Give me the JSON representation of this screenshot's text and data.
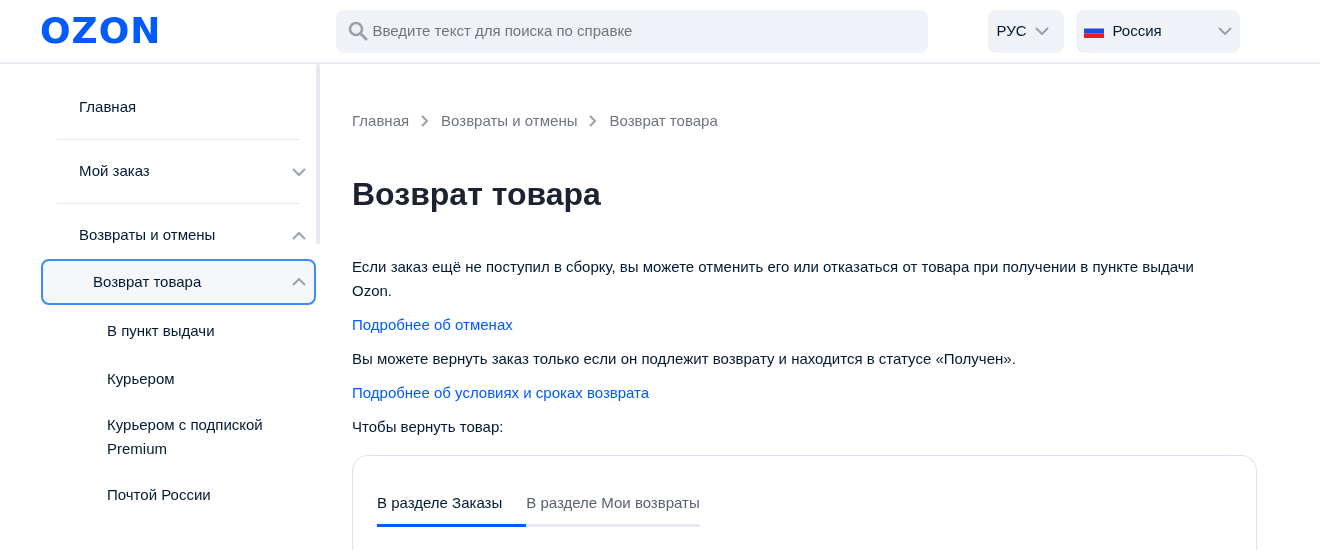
{
  "header": {
    "logo": "OZON",
    "search": {
      "placeholder": "Введите текст для поиска по справке"
    },
    "language": "РУС",
    "country": "Россия"
  },
  "sidebar": {
    "items": [
      {
        "label": "Главная",
        "selected": false
      },
      {
        "label": "Мой заказ",
        "selected": false,
        "expanded": false
      },
      {
        "label": "Возвраты и отмены",
        "selected": false,
        "expanded": true,
        "children": [
          {
            "label": "Возврат товара",
            "selected": true,
            "expanded": true,
            "children": [
              {
                "label": "В пункт выдачи",
                "selected": false
              },
              {
                "label": "Курьером",
                "selected": false
              },
              {
                "label": "Курьером с подпиской Premium",
                "selected": false
              },
              {
                "label": "Почтой России",
                "selected": false
              }
            ]
          }
        ]
      }
    ]
  },
  "breadcrumbs": [
    "Главная",
    "Возвраты и отмены",
    "Возврат товара"
  ],
  "title": "Возврат товара",
  "content": [
    {
      "kind": "text",
      "text": "Если заказ ещё не поступил в сборку, вы можете отменить его или отказаться от товара при получении в пункте выдачи Ozon."
    },
    {
      "kind": "link",
      "text": "Подробнее об отменах"
    },
    {
      "kind": "text",
      "text": "Вы можете вернуть заказ только если он подлежит возврату и находится в статусе «Получен»."
    },
    {
      "kind": "link",
      "text": "Подробнее об условиях и сроках возврата"
    },
    {
      "kind": "text",
      "text": "Чтобы вернуть товар:"
    }
  ],
  "tabs": [
    {
      "label": "В разделе Заказы",
      "selected": true
    },
    {
      "label": "В разделе Мои возвраты",
      "selected": false
    }
  ]
}
